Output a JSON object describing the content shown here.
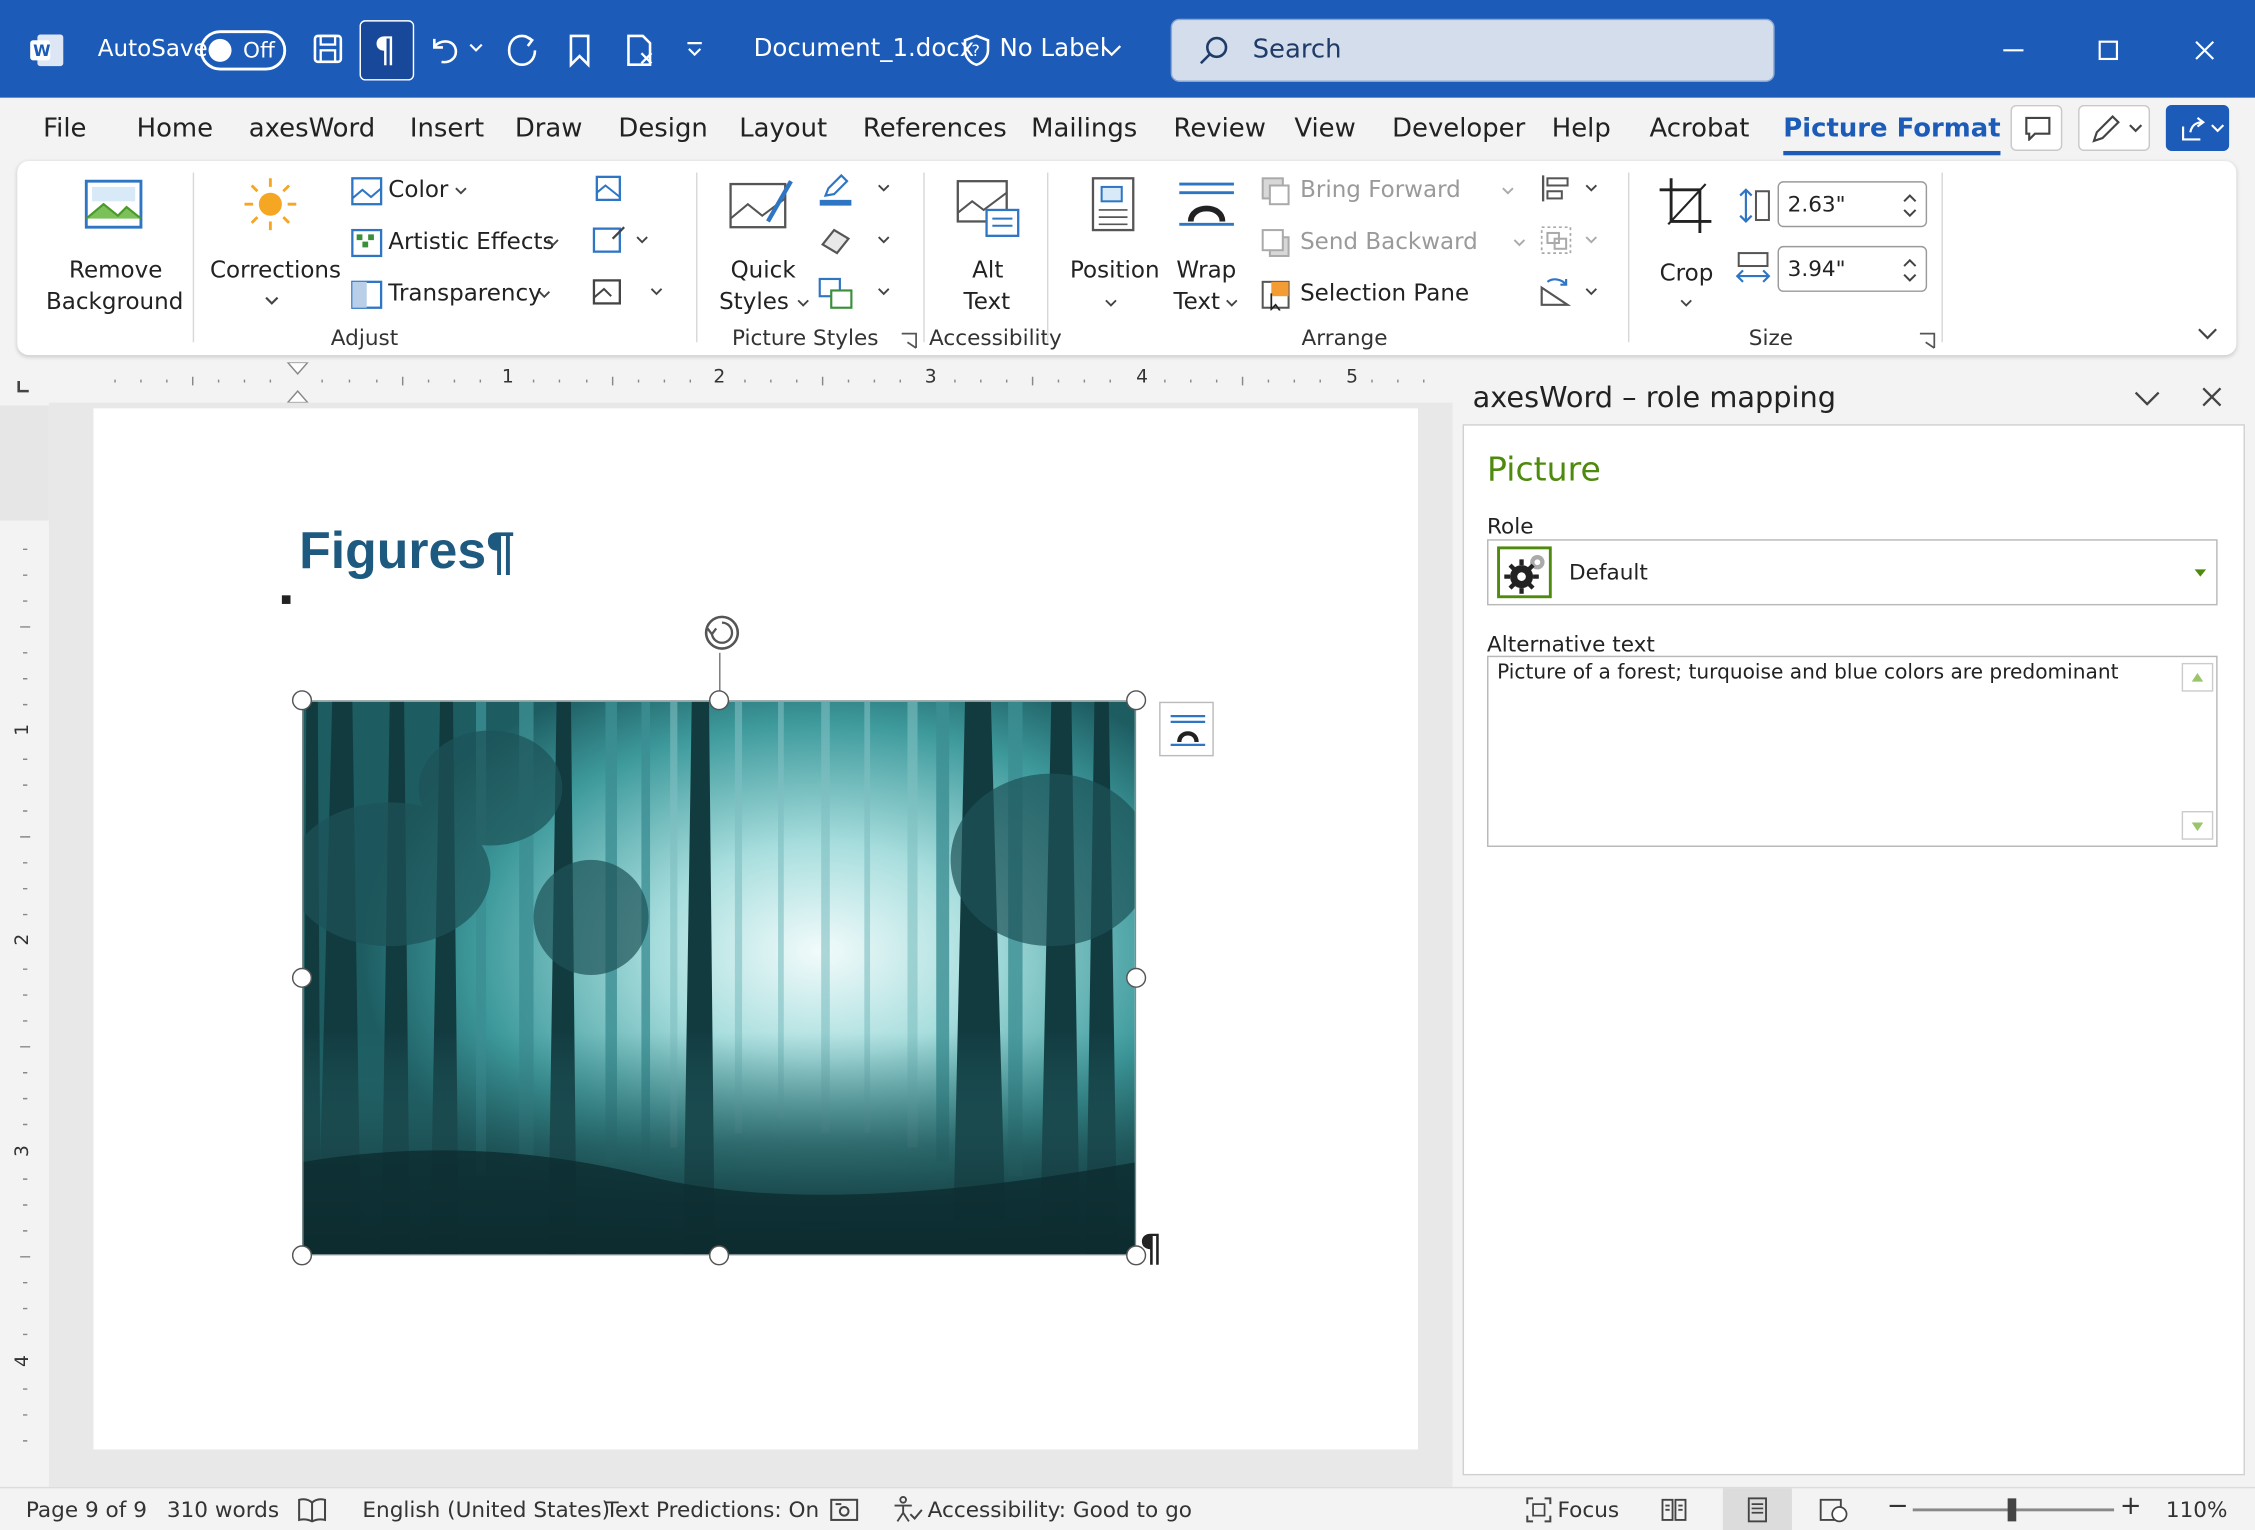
{
  "titlebar": {
    "autosave_label": "AutoSave",
    "autosave_state": "Off",
    "filename": "Document_1.docx",
    "sensitivity": "No Label",
    "search_placeholder": "Search"
  },
  "tabs": [
    "File",
    "Home",
    "axesWord",
    "Insert",
    "Draw",
    "Design",
    "Layout",
    "References",
    "Mailings",
    "Review",
    "View",
    "Developer",
    "Help",
    "Acrobat",
    "Picture Format"
  ],
  "active_tab": "Picture Format",
  "ribbon": {
    "remove_bg_1": "Remove",
    "remove_bg_2": "Background",
    "corrections": "Corrections",
    "color": "Color",
    "artistic": "Artistic Effects",
    "transparency": "Transparency",
    "adjust": "Adjust",
    "quick_styles_1": "Quick",
    "quick_styles_2": "Styles",
    "picture_styles": "Picture Styles",
    "alt_text_1": "Alt",
    "alt_text_2": "Text",
    "accessibility": "Accessibility",
    "position": "Position",
    "wrap_1": "Wrap",
    "wrap_2": "Text",
    "bring_forward": "Bring Forward",
    "send_backward": "Send Backward",
    "selection_pane": "Selection Pane",
    "arrange": "Arrange",
    "crop": "Crop",
    "height": "2.63\"",
    "width": "3.94\"",
    "size": "Size"
  },
  "ruler": [
    "1",
    "2",
    "3",
    "4",
    "5"
  ],
  "ruler_v": [
    "1",
    "2",
    "3",
    "4"
  ],
  "document": {
    "heading": "Figures¶",
    "pilcrow": "¶"
  },
  "pane": {
    "title": "axesWord – role mapping",
    "heading": "Picture",
    "role_label": "Role",
    "role_value": "Default",
    "alt_label": "Alternative text",
    "alt_value": "Picture of a forest; turquoise and blue colors are predominant"
  },
  "status": {
    "page": "Page 9 of 9",
    "words": "310 words",
    "language": "English (United States)",
    "predictions": "Text Predictions: On",
    "accessibility": "Accessibility: Good to go",
    "focus": "Focus",
    "zoom": "110%"
  },
  "colors": {
    "titlebar": "#1c5bb8",
    "accent": "#1c5bb8",
    "pane_heading": "#4e8a0e",
    "heading": "#1e5a80"
  }
}
